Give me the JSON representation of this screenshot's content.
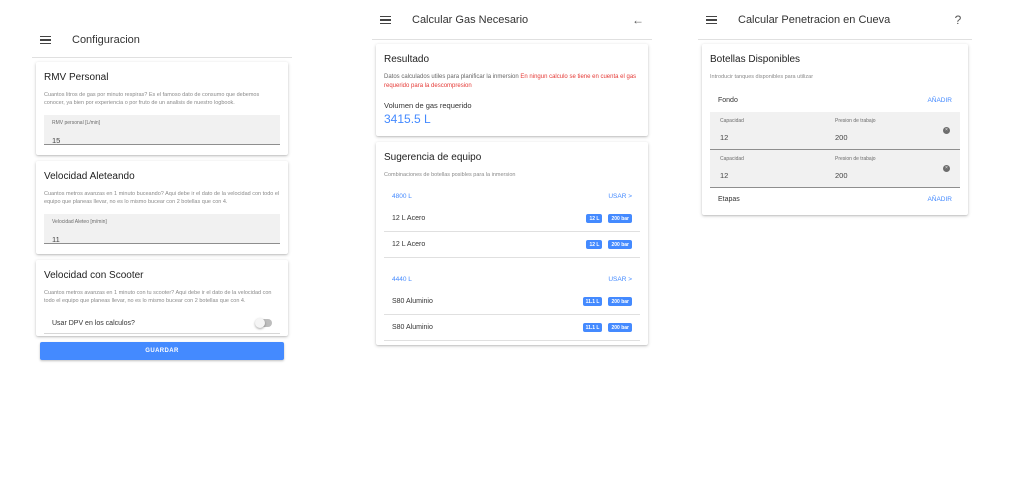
{
  "config": {
    "title": "Configuracion",
    "rmv": {
      "title": "RMV Personal",
      "desc": "Cuantos litros de gas por minuto respiras? Es el famoso dato de consumo que debemos conocer, ya bien por experiencia o por fruto de un analisis de nuestro logbook.",
      "field_label": "RMV personal [L/min]",
      "field_value": "15"
    },
    "aleteo": {
      "title": "Velocidad Aleteando",
      "desc": "Cuantos metros avanzas en 1 minuto buceando? Aqui debe ir el dato de la velocidad con todo el equipo que planeas llevar, no es lo mismo bucear con 2 botellas que con 4.",
      "field_label": "Velocidad Aleteo [m/min]",
      "field_value": "11"
    },
    "scooter": {
      "title": "Velocidad con Scooter",
      "desc": "Cuantos metros avanzas en 1 minuto con tu scooter? Aqui debe ir el dato de la velocidad con todo el equipo que planeas llevar, no es lo mismo bucear con 2 botellas que con 4.",
      "toggle_label": "Usar DPV en los calculos?",
      "toggle_on": false
    },
    "save_label": "GUARDAR"
  },
  "gas": {
    "title": "Calcular Gas Necesario",
    "back_icon": "arrow-back-icon",
    "result": {
      "title": "Resultado",
      "text": "Datos calculados utiles para planificar la inmersion",
      "warning": "En ningun calculo se tiene en cuenta el gas requerido para la descompresion",
      "volume_label": "Volumen de gas requerido",
      "volume_value": "3415.5 L"
    },
    "suggest": {
      "title": "Sugerencia de equipo",
      "desc": "Combinaciones de botellas posibles para la inmersion",
      "use_label": "USAR >",
      "groups": [
        {
          "capacity": "4800 L",
          "tanks": [
            {
              "name": "12 L Acero",
              "vol": "12 L",
              "pressure": "200 bar"
            },
            {
              "name": "12 L Acero",
              "vol": "12 L",
              "pressure": "200 bar"
            }
          ]
        },
        {
          "capacity": "4440 L",
          "tanks": [
            {
              "name": "S80 Aluminio",
              "vol": "11.1 L",
              "pressure": "200 bar"
            },
            {
              "name": "S80 Aluminio",
              "vol": "11.1 L",
              "pressure": "200 bar"
            }
          ]
        }
      ]
    }
  },
  "cave": {
    "title": "Calcular Penetracion en Cueva",
    "help_icon": "?",
    "card_title": "Botellas Disponibles",
    "card_desc": "Introducir tanques disponibles para utilizar",
    "fondo_label": "Fondo",
    "add_label": "AÑADIR",
    "etapas_label": "Etapas",
    "capacity_label": "Capacidad",
    "pressure_label": "Presion de trabajo",
    "bottles": [
      {
        "capacity": "12",
        "pressure": "200"
      },
      {
        "capacity": "12",
        "pressure": "200"
      }
    ]
  },
  "colors": {
    "accent": "#448aff",
    "warning": "#e53935"
  }
}
